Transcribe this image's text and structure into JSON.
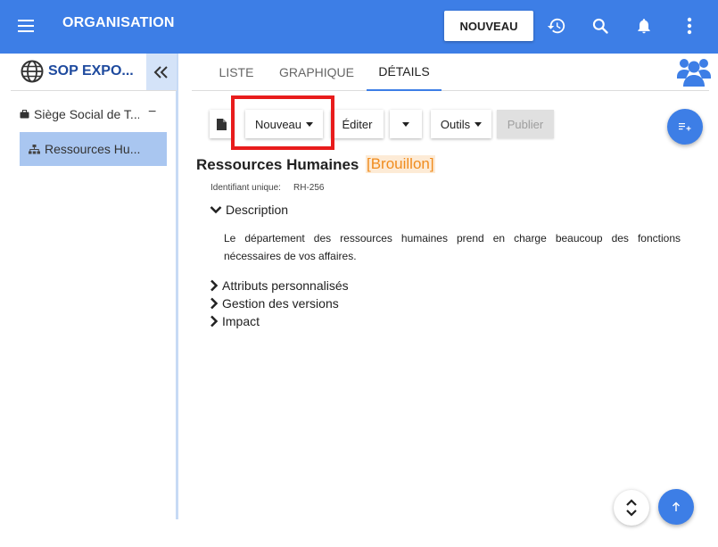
{
  "header": {
    "title": "ORGANISATION",
    "new_button": "NOUVEAU",
    "icons": [
      "menu-icon",
      "history-icon",
      "search-icon",
      "bell-icon",
      "more-vert-icon"
    ]
  },
  "sidebar": {
    "title": "SOP EXPO...",
    "items": [
      {
        "label": "Siège Social de T...",
        "icon": "briefcase-icon",
        "toggle": "−"
      },
      {
        "label": "Ressources Hu...",
        "icon": "org-chart-icon",
        "selected": true
      }
    ]
  },
  "tabs": [
    {
      "label": "LISTE"
    },
    {
      "label": "GRAPHIQUE"
    },
    {
      "label": "DÉTAILS",
      "active": true
    }
  ],
  "toolbar": {
    "new_label": "Nouveau",
    "edit_label": "Éditer",
    "tools_label": "Outils",
    "publish_label": "Publier"
  },
  "details": {
    "title": "Ressources Humaines",
    "status": "[Brouillon]",
    "uid_label": "Identifiant unique:",
    "uid_value": "RH-256",
    "sections": {
      "description": "Description",
      "description_text": "Le département des ressources humaines prend en charge beaucoup des fonctions nécessaires de vos affaires.",
      "custom_attributes": "Attributs personnalisés",
      "versions": "Gestion des versions",
      "impact": "Impact"
    }
  },
  "colors": {
    "primary": "#3d7ee6",
    "sidebar_title": "#1e4a9e",
    "selected_item": "#a9c6f0",
    "draft_status": "#f08c1e",
    "highlight": "#e81c1c"
  }
}
